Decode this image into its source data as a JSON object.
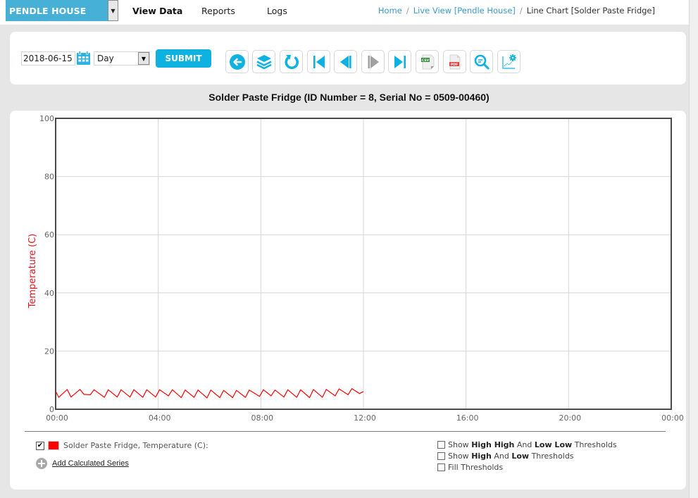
{
  "topbar": {
    "site_select": "PENDLE HOUSE",
    "nav": [
      {
        "label": "View Data",
        "active": true
      },
      {
        "label": "Reports",
        "active": false
      },
      {
        "label": "Logs",
        "active": false
      }
    ],
    "breadcrumb": [
      {
        "label": "Home",
        "link": true
      },
      {
        "label": "Live View [Pendle House]",
        "link": true
      },
      {
        "label": "Line Chart [Solder Paste Fridge]",
        "link": false
      }
    ]
  },
  "toolbar": {
    "date_value": "2018-06-15",
    "period_value": "Day",
    "submit_label": "SUBMIT",
    "buttons": [
      {
        "icon": "back-arrow-icon"
      },
      {
        "icon": "layers-icon"
      },
      {
        "icon": "refresh-icon"
      },
      {
        "icon": "first-page-icon"
      },
      {
        "icon": "previous-icon"
      },
      {
        "icon": "next-icon",
        "disabled": true
      },
      {
        "icon": "last-page-icon"
      },
      {
        "icon": "csv-export-icon",
        "label": "CSV"
      },
      {
        "icon": "pdf-export-icon",
        "label": "PDF"
      },
      {
        "icon": "zoom-search-icon"
      },
      {
        "icon": "chart-settings-icon"
      }
    ],
    "accent_color": "#0eb2e0"
  },
  "chart_title": "Solder Paste Fridge (ID Number = 8, Serial No = 0509-00460)",
  "chart_data": {
    "type": "line",
    "title": "Solder Paste Fridge (ID Number = 8, Serial No = 0509-00460)",
    "xlabel": "",
    "ylabel": "Temperature (C)",
    "ylim": [
      0,
      100
    ],
    "xlim_hours": [
      0,
      24
    ],
    "y_ticks": [
      "0",
      "20",
      "40",
      "60",
      "80",
      "100"
    ],
    "x_ticks": [
      "00:00",
      "04:00",
      "08:00",
      "12:00",
      "16:00",
      "20:00",
      "00:00"
    ],
    "grid": true,
    "series": [
      {
        "name": "Solder Paste Fridge, Temperature (C)",
        "color": "#ff0000",
        "x_hours": [
          0.0,
          0.12,
          0.45,
          0.6,
          0.95,
          1.1,
          1.35,
          1.5,
          1.9,
          2.05,
          2.4,
          2.55,
          2.9,
          3.05,
          3.4,
          3.55,
          3.9,
          4.05,
          4.4,
          4.55,
          4.9,
          5.05,
          5.4,
          5.55,
          5.9,
          6.05,
          6.4,
          6.55,
          6.9,
          7.05,
          7.4,
          7.55,
          7.95,
          8.1,
          8.4,
          8.55,
          8.9,
          9.05,
          9.4,
          9.55,
          9.9,
          10.05,
          10.4,
          10.55,
          10.9,
          11.05,
          11.4,
          11.55,
          11.85,
          12.0
        ],
        "values": [
          6.2,
          4.1,
          6.8,
          4.2,
          6.8,
          5.1,
          5.0,
          6.7,
          4.1,
          6.7,
          4.2,
          6.7,
          4.2,
          6.7,
          4.1,
          6.7,
          4.2,
          6.7,
          4.6,
          6.7,
          4.0,
          6.6,
          4.1,
          6.6,
          3.9,
          6.6,
          4.0,
          6.5,
          4.0,
          6.5,
          4.1,
          6.6,
          4.4,
          6.7,
          4.6,
          6.6,
          4.2,
          6.7,
          4.1,
          6.7,
          4.0,
          6.8,
          4.1,
          6.8,
          4.6,
          7.0,
          5.0,
          7.1,
          5.4,
          6.1
        ]
      }
    ]
  },
  "legend": {
    "series_label": "Solder Paste Fridge, Temperature (C):",
    "series_checked": true,
    "add_calculated_series": "Add Calculated Series"
  },
  "thresholds": [
    {
      "parts": [
        {
          "t": "Show ",
          "b": false
        },
        {
          "t": "High High",
          "b": true
        },
        {
          "t": " And ",
          "b": false
        },
        {
          "t": "Low Low",
          "b": true
        },
        {
          "t": " Thresholds",
          "b": false
        }
      ],
      "checked": false
    },
    {
      "parts": [
        {
          "t": "Show ",
          "b": false
        },
        {
          "t": "High",
          "b": true
        },
        {
          "t": " And ",
          "b": false
        },
        {
          "t": "Low",
          "b": true
        },
        {
          "t": " Thresholds",
          "b": false
        }
      ],
      "checked": false
    },
    {
      "parts": [
        {
          "t": "Fill Thresholds",
          "b": false
        }
      ],
      "checked": false
    }
  ]
}
